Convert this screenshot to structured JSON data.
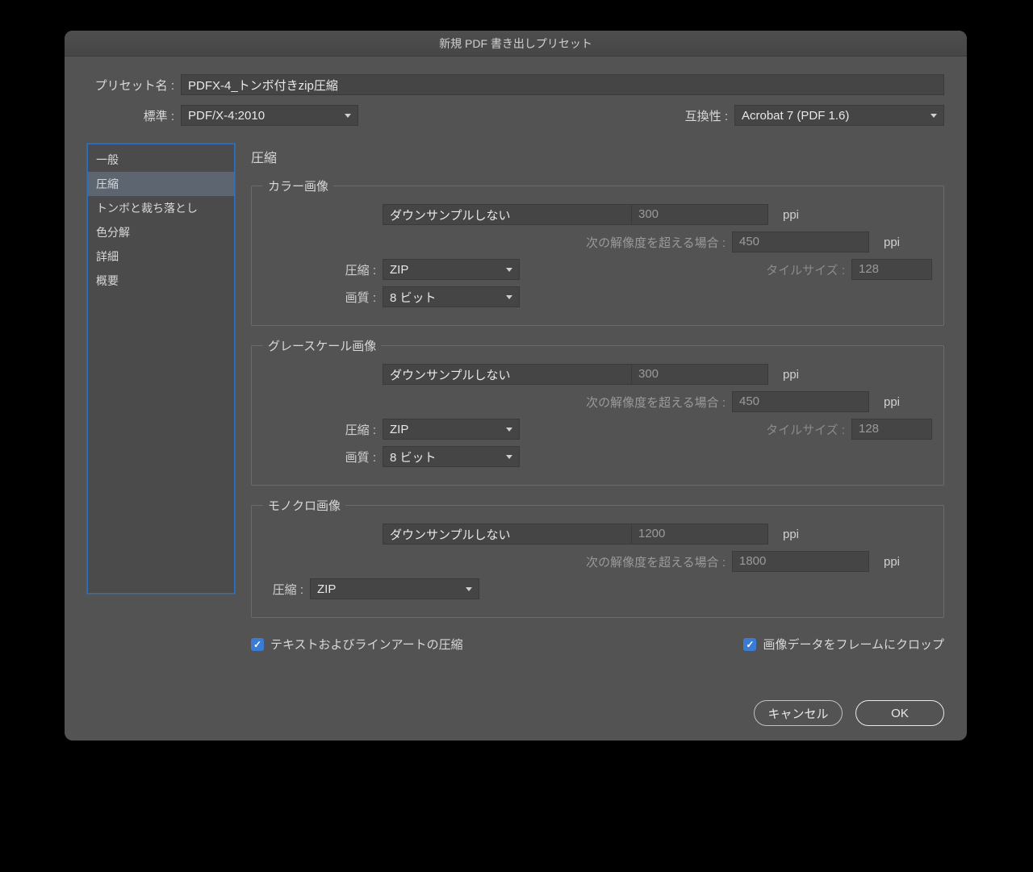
{
  "window": {
    "title": "新規 PDF 書き出しプリセット"
  },
  "header": {
    "preset_name_label": "プリセット名 :",
    "preset_name": "PDFX-4_トンボ付きzip圧縮",
    "standard_label": "標準 :",
    "standard": "PDF/X-4:2010",
    "compat_label": "互換性 :",
    "compat": "Acrobat 7 (PDF 1.6)"
  },
  "sidebar": {
    "items": [
      {
        "label": "一般"
      },
      {
        "label": "圧縮"
      },
      {
        "label": "トンボと裁ち落とし"
      },
      {
        "label": "色分解"
      },
      {
        "label": "詳細"
      },
      {
        "label": "概要"
      }
    ],
    "selected_index": 1
  },
  "main": {
    "title": "圧縮",
    "color": {
      "legend": "カラー画像",
      "downsample": "ダウンサンプルしない",
      "ppi": "300",
      "ppi_unit": "ppi",
      "over_label": "次の解像度を超える場合 :",
      "over_ppi": "450",
      "compression_label": "圧縮 :",
      "compression": "ZIP",
      "tilesize_label": "タイルサイズ :",
      "tilesize": "128",
      "quality_label": "画質 :",
      "quality": "8 ビット"
    },
    "gray": {
      "legend": "グレースケール画像",
      "downsample": "ダウンサンプルしない",
      "ppi": "300",
      "ppi_unit": "ppi",
      "over_label": "次の解像度を超える場合 :",
      "over_ppi": "450",
      "compression_label": "圧縮 :",
      "compression": "ZIP",
      "tilesize_label": "タイルサイズ :",
      "tilesize": "128",
      "quality_label": "画質 :",
      "quality": "8 ビット"
    },
    "mono": {
      "legend": "モノクロ画像",
      "downsample": "ダウンサンプルしない",
      "ppi": "1200",
      "ppi_unit": "ppi",
      "over_label": "次の解像度を超える場合 :",
      "over_ppi": "1800",
      "compression_label": "圧縮 :",
      "compression": "ZIP"
    },
    "check_text_art": "テキストおよびラインアートの圧縮",
    "check_crop": "画像データをフレームにクロップ"
  },
  "footer": {
    "cancel": "キャンセル",
    "ok": "OK"
  }
}
